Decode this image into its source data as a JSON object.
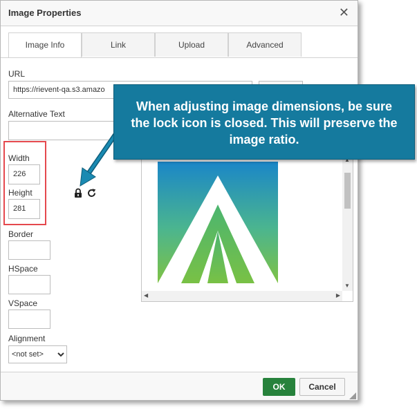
{
  "dialog": {
    "title": "Image Properties",
    "close_glyph": "✕"
  },
  "tabs": [
    {
      "label": "Image Info",
      "active": true
    },
    {
      "label": "Link",
      "active": false
    },
    {
      "label": "Upload",
      "active": false
    },
    {
      "label": "Advanced",
      "active": false
    }
  ],
  "form": {
    "url_label": "URL",
    "url_value": "https://rievent-qa.s3.amazo",
    "alt_label": "Alternative Text",
    "alt_value": "",
    "width_label": "Width",
    "width_value": "226",
    "height_label": "Height",
    "height_value": "281",
    "border_label": "Border",
    "border_value": "",
    "hspace_label": "HSpace",
    "hspace_value": "",
    "vspace_label": "VSpace",
    "vspace_value": "",
    "alignment_label": "Alignment",
    "alignment_selected": "<not set>"
  },
  "icons": {
    "lock": "lock-icon",
    "reset": "reset-size-icon"
  },
  "footer": {
    "ok_label": "OK",
    "cancel_label": "Cancel",
    "ok_color": "#27823c"
  },
  "callout": {
    "text": "When adjusting image dimensions, be sure the lock icon is closed. This will preserve the image ratio.",
    "background": "#157a9e"
  },
  "highlight_color": "#e5484d"
}
